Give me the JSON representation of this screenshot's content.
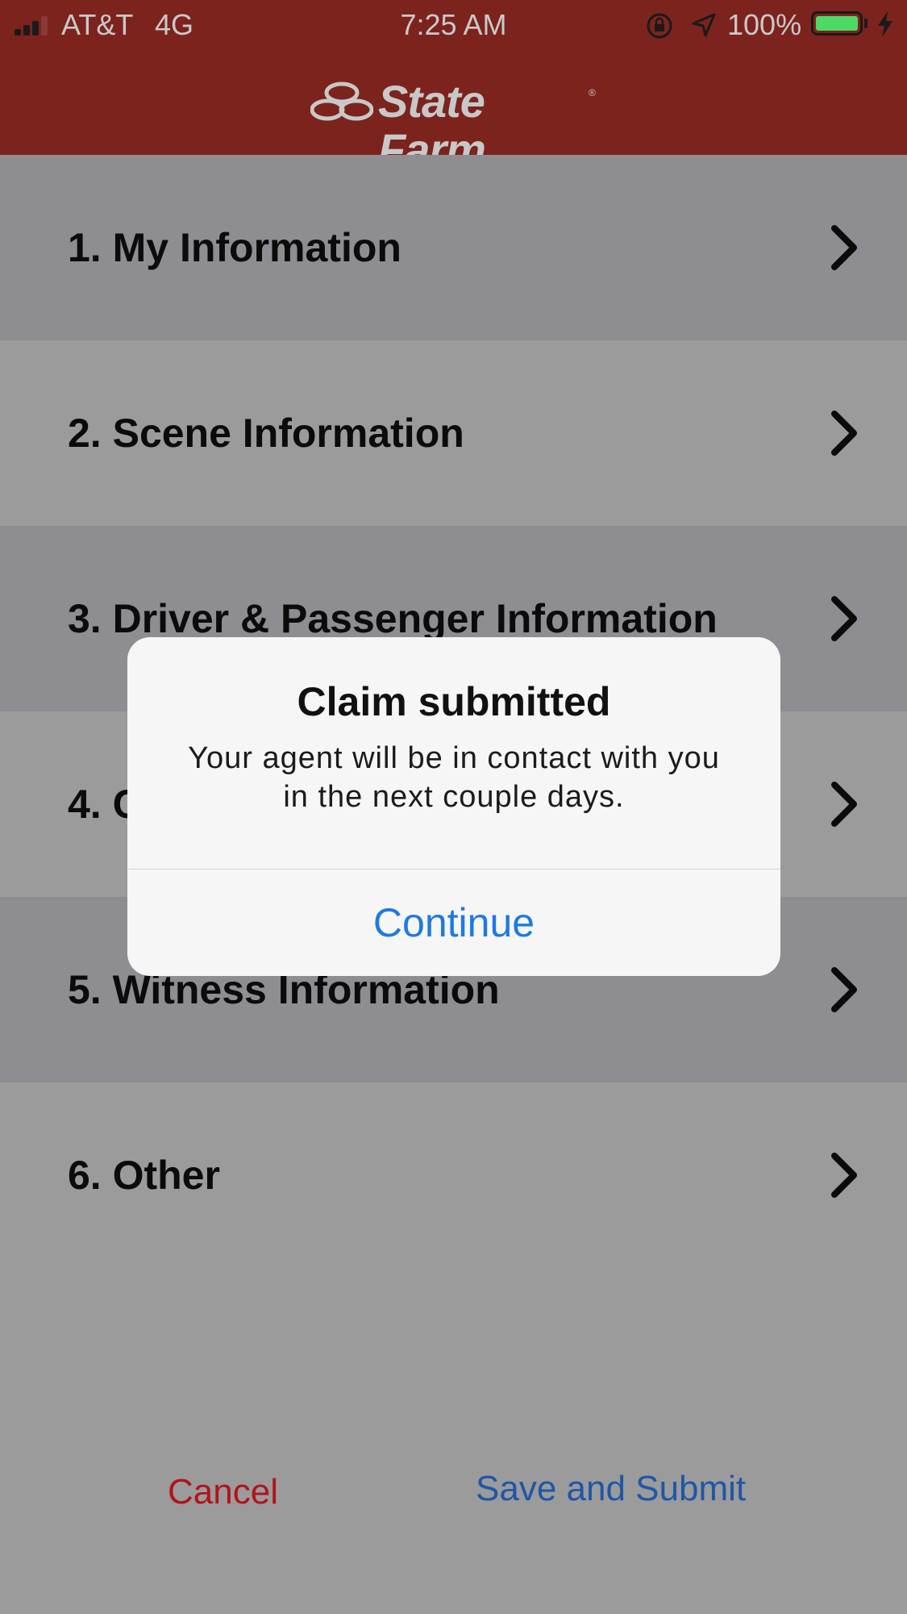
{
  "status_bar": {
    "carrier": "AT&T",
    "network": "4G",
    "time": "7:25 AM",
    "battery_percent": "100%",
    "battery_level": 1.0,
    "icons": [
      "signal-icon",
      "orientation-lock-icon",
      "location-icon",
      "battery-icon",
      "charging-bolt-icon"
    ]
  },
  "header": {
    "brand_name": "State Farm",
    "brand_mark": "®",
    "background_color": "#7c231d"
  },
  "menu": {
    "items": [
      {
        "label": "1. My Information"
      },
      {
        "label": "2. Scene Information"
      },
      {
        "label": "3. Driver & Passenger Information"
      },
      {
        "label": "4. C"
      },
      {
        "label": "5. Witness Information"
      },
      {
        "label": "6. Other"
      }
    ]
  },
  "footer": {
    "cancel_label": "Cancel",
    "save_label": "Save and Submit"
  },
  "dialog": {
    "title": "Claim submitted",
    "message": "Your agent will be in contact with you in the next couple days.",
    "button_label": "Continue",
    "accent_color": "#1e7ae0"
  }
}
